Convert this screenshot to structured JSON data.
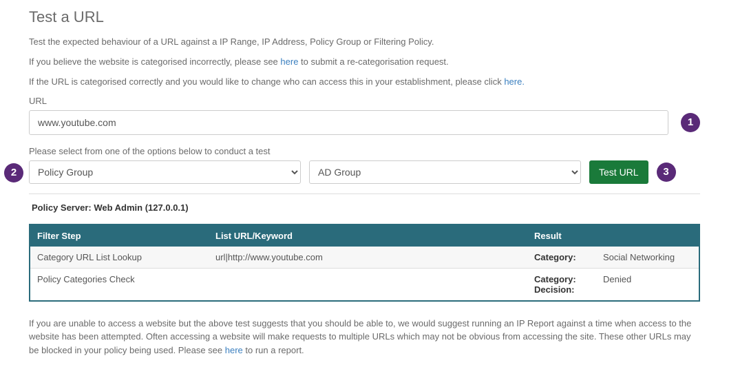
{
  "title": "Test a URL",
  "intro": {
    "p1": "Test the expected behaviour of a URL against a IP Range, IP Address, Policy Group or Filtering Policy.",
    "p2a": "If you believe the website is categorised incorrectly, please see ",
    "p2_link": "here",
    "p2b": " to submit a re-categorisation request.",
    "p3a": "If the URL is categorised correctly and you would like to change who can access this in your establishment, please click ",
    "p3_link": "here.",
    "p3b": ""
  },
  "url_label": "URL",
  "url_value": "www.youtube.com",
  "select_label": "Please select from one of the options below to conduct a test",
  "select1": "Policy Group",
  "select2": "AD Group",
  "test_btn": "Test URL",
  "badges": {
    "b1": "1",
    "b2": "2",
    "b3": "3"
  },
  "server": {
    "label": "Policy Server: ",
    "value": "Web Admin (127.0.0.1)"
  },
  "table": {
    "headers": {
      "step": "Filter Step",
      "list": "List URL/Keyword",
      "result": "Result"
    },
    "rows": [
      {
        "step": "Category URL List Lookup",
        "list": "url|http://www.youtube.com",
        "pairs": [
          {
            "k": "Category:",
            "v": "Social Networking"
          }
        ]
      },
      {
        "step": "Policy Categories Check",
        "list": "",
        "pairs": [
          {
            "k": "Category:",
            "v": ""
          },
          {
            "k": "Decision:",
            "v": "Denied"
          }
        ]
      }
    ]
  },
  "footer": {
    "a": "If you are unable to access a website but the above test suggests that you should be able to, we would suggest running an IP Report against a time when access to the website has been attempted. Often accessing a website will make requests to multiple URLs which may not be obvious from accessing the site. These other URLs may be blocked in your policy being used. Please see ",
    "link": "here",
    "b": " to run a report."
  }
}
